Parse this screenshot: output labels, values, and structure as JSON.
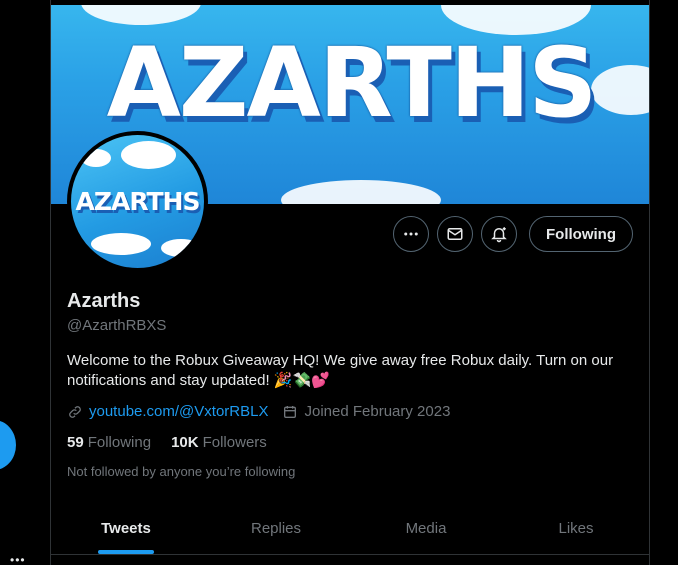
{
  "colors": {
    "accent": "#1d9bf0",
    "background": "#000000",
    "text": "#e7e9ea",
    "muted": "#71767b",
    "border": "#2f3336"
  },
  "banner": {
    "title": "AZARTHS"
  },
  "avatar": {
    "text": "AZARTHS"
  },
  "actions": {
    "more_icon": "more-icon",
    "message_icon": "envelope-icon",
    "notify_icon": "bell-icon",
    "follow_label": "Following"
  },
  "profile": {
    "name": "Azarths",
    "handle": "@AzarthRBXS",
    "bio": "Welcome to the Robux Giveaway HQ! We give away free Robux daily. Turn on our notifications and stay updated! 🎉💸💕",
    "link": "youtube.com/@VxtorRBLX",
    "joined": "Joined February 2023"
  },
  "stats": {
    "following_count": "59",
    "following_label": "Following",
    "followers_count": "10K",
    "followers_label": "Followers"
  },
  "not_followed_text": "Not followed by anyone you’re following",
  "tabs": [
    {
      "label": "Tweets",
      "active": true
    },
    {
      "label": "Replies",
      "active": false
    },
    {
      "label": "Media",
      "active": false
    },
    {
      "label": "Likes",
      "active": false
    }
  ]
}
